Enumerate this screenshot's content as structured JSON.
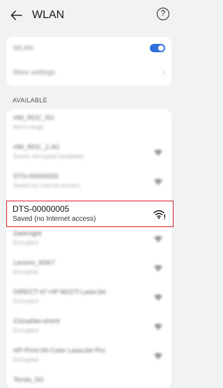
{
  "header": {
    "title": "WLAN",
    "help_symbol": "?"
  },
  "settings": {
    "wlan_label": "WLAN",
    "wlan_enabled": true,
    "more_settings_label": "More settings"
  },
  "available_label": "AVAILABLE",
  "networks": [
    {
      "name": "HM_RDC_5G",
      "status": "Not in range"
    },
    {
      "name": "HM_RDC_2.4G",
      "status": "Saved, encrypted (available)"
    },
    {
      "name": "DTS-00000003",
      "status": "Saved (no Internet access)"
    },
    {
      "name": "DTS-00000005",
      "status": "Saved (no Internet access)"
    },
    {
      "name": "Darknight",
      "status": "Encrypted"
    },
    {
      "name": "Lenovo_6DK7",
      "status": "Encrypted"
    },
    {
      "name": "DIRECT-47-HP M227f LaserJet",
      "status": "Encrypted"
    },
    {
      "name": "ChinaNet-ehImf",
      "status": "Encrypted"
    },
    {
      "name": "HP-Print-06-Color LaserJet Pro",
      "status": "Encrypted"
    },
    {
      "name": "Tenda_5G",
      "status": ""
    }
  ],
  "colors": {
    "accent": "#2f6fd8",
    "highlight_border": "#d61f26"
  }
}
